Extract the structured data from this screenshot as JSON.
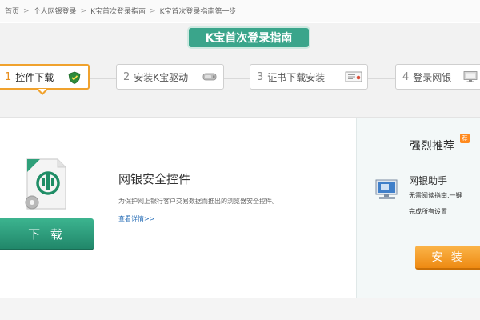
{
  "breadcrumb": {
    "items": [
      "首页",
      "个人网银登录",
      "K宝首次登录指南",
      "K宝首次登录指南第一步"
    ],
    "separator": ">"
  },
  "guide": {
    "title": "K宝首次登录指南"
  },
  "steps": [
    {
      "num": "1",
      "label": "控件下载",
      "icon": "shield-icon",
      "active": true
    },
    {
      "num": "2",
      "label": "安装K宝驱动",
      "icon": "usb-key-icon",
      "active": false
    },
    {
      "num": "3",
      "label": "证书下载安装",
      "icon": "certificate-icon",
      "active": false
    },
    {
      "num": "4",
      "label": "登录网银",
      "icon": "monitor-icon",
      "active": false
    }
  ],
  "control": {
    "title": "网银安全控件",
    "description": "为保护网上银行客户交易数据而推出的浏览器安全控件。",
    "link": "查看详情>>",
    "download_label": "下 载"
  },
  "recommend": {
    "title": "强烈推荐",
    "badge": "荐",
    "helper_name": "网银助手",
    "helper_desc_line1": "无需阅读指南,一键",
    "helper_desc_line2": "完成所有设置",
    "install_label": "安 装"
  },
  "colors": {
    "accent_green": "#3aa58b",
    "active_orange": "#f0a22e",
    "install_orange": "#ee8a12",
    "link_blue": "#2a6fb7"
  }
}
